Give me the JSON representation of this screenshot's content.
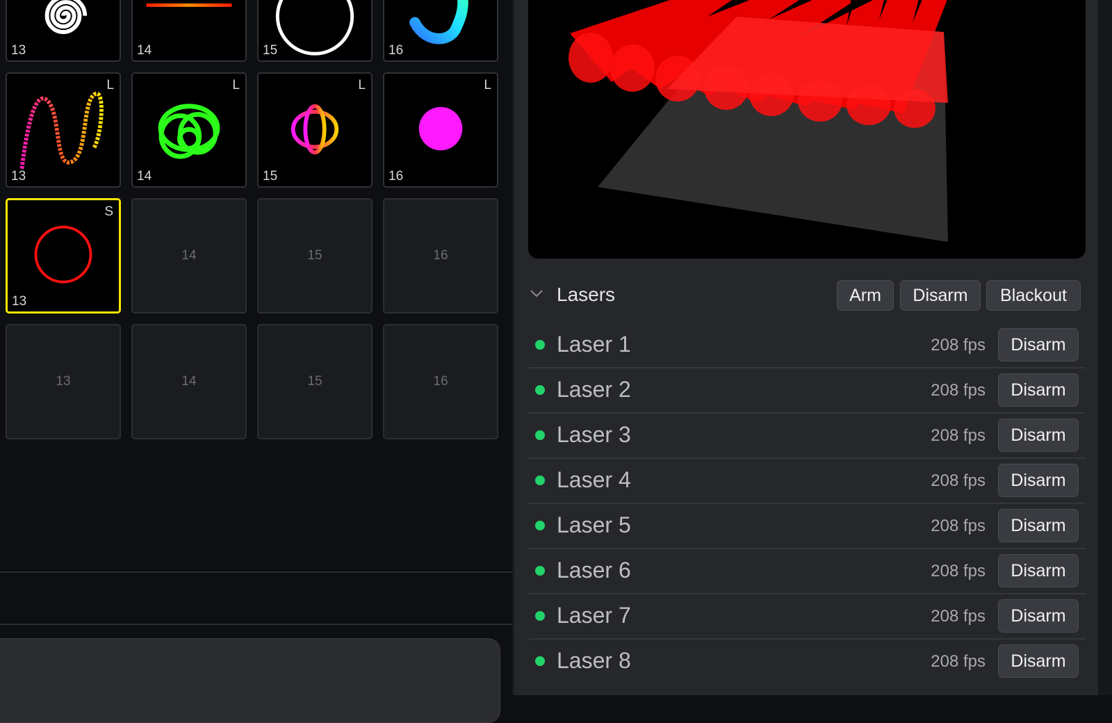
{
  "grid": {
    "rows": [
      [
        {
          "num": "13",
          "mode": "",
          "art": "spiral-icon"
        },
        {
          "num": "14",
          "mode": "",
          "art": "line-icon"
        },
        {
          "num": "15",
          "mode": "",
          "art": "ring-icon"
        },
        {
          "num": "16",
          "mode": "",
          "art": "wave-icon"
        }
      ],
      [
        {
          "num": "13",
          "mode": "L",
          "art": "sine-icon"
        },
        {
          "num": "14",
          "mode": "L",
          "art": "knot-icon"
        },
        {
          "num": "15",
          "mode": "L",
          "art": "lissajous-icon"
        },
        {
          "num": "16",
          "mode": "L",
          "art": "dot-icon"
        }
      ],
      [
        {
          "num": "13",
          "mode": "S",
          "art": "circle-icon",
          "selected": true
        },
        {
          "num": "14",
          "empty": true
        },
        {
          "num": "15",
          "empty": true
        },
        {
          "num": "16",
          "empty": true
        }
      ],
      [
        {
          "num": "13",
          "empty": true
        },
        {
          "num": "14",
          "empty": true
        },
        {
          "num": "15",
          "empty": true
        },
        {
          "num": "16",
          "empty": true
        }
      ]
    ]
  },
  "lasers": {
    "title": "Lasers",
    "arm_label": "Arm",
    "disarm_label": "Disarm",
    "blackout_label": "Blackout",
    "items": [
      {
        "name": "Laser 1",
        "fps": "208 fps",
        "action": "Disarm",
        "status": "armed"
      },
      {
        "name": "Laser 2",
        "fps": "208 fps",
        "action": "Disarm",
        "status": "armed"
      },
      {
        "name": "Laser 3",
        "fps": "208 fps",
        "action": "Disarm",
        "status": "armed"
      },
      {
        "name": "Laser 4",
        "fps": "208 fps",
        "action": "Disarm",
        "status": "armed"
      },
      {
        "name": "Laser 5",
        "fps": "208 fps",
        "action": "Disarm",
        "status": "armed"
      },
      {
        "name": "Laser 6",
        "fps": "208 fps",
        "action": "Disarm",
        "status": "armed"
      },
      {
        "name": "Laser 7",
        "fps": "208 fps",
        "action": "Disarm",
        "status": "armed"
      },
      {
        "name": "Laser 8",
        "fps": "208 fps",
        "action": "Disarm",
        "status": "armed"
      }
    ]
  },
  "colors": {
    "selection": "#ffe600",
    "armed": "#22d36b",
    "beam": "#ff0000"
  }
}
